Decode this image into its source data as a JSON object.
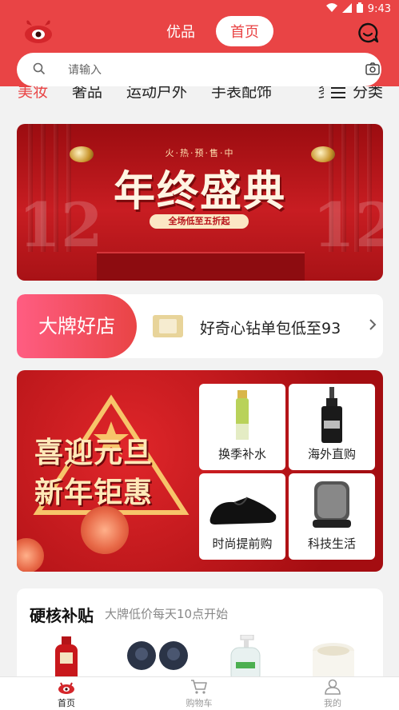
{
  "status": {
    "time": "9:43"
  },
  "header": {
    "tabs": [
      {
        "label": "优品"
      },
      {
        "label": "首页"
      }
    ],
    "search_placeholder": "请输入"
  },
  "categories": {
    "items": [
      "美妆",
      "奢品",
      "运动户外",
      "手表配饰"
    ],
    "more_label": "分类"
  },
  "banner": {
    "tagline": "火·热·预·售·中",
    "headline": "年终盛典",
    "pill": "全场低至五折起",
    "deco_number": "12"
  },
  "brand": {
    "badge": "大牌好店",
    "promo_text": "好奇心钻单包低至93"
  },
  "promo": {
    "title_line1": "喜迎元旦",
    "title_line2": "新年钜惠",
    "tiles": [
      {
        "label": "换季补水"
      },
      {
        "label": "海外直购"
      },
      {
        "label": "时尚提前购"
      },
      {
        "label": "科技生活"
      }
    ]
  },
  "subsidy": {
    "title": "硬核补贴",
    "subtitle": "大牌低价每天10点开始"
  },
  "bottom_nav": [
    {
      "label": "首页"
    },
    {
      "label": "购物车"
    },
    {
      "label": "我的"
    }
  ],
  "colors": {
    "brand_red": "#e94445",
    "page_bg": "#f2f2f2"
  }
}
